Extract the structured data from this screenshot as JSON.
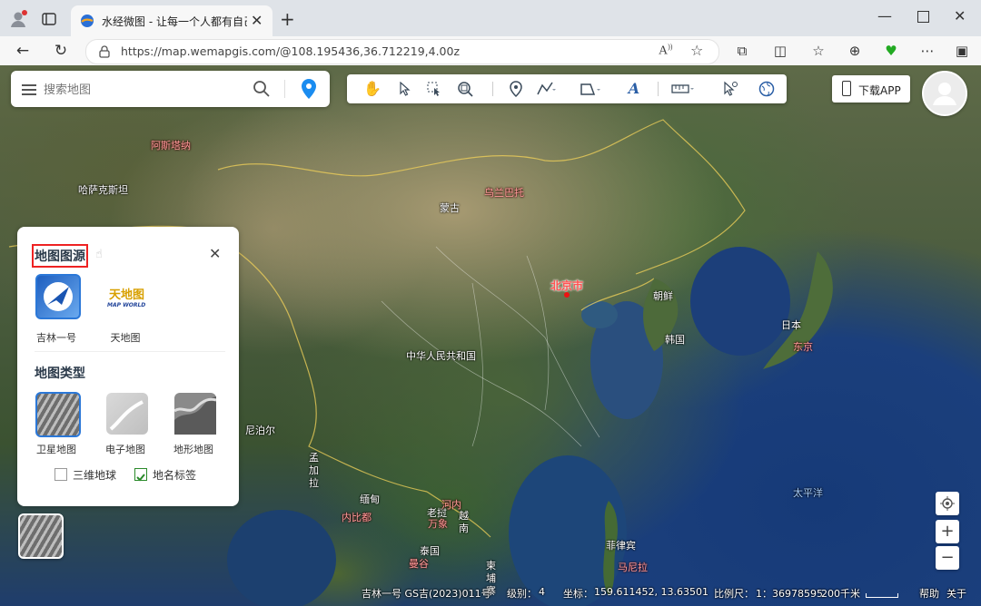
{
  "browser": {
    "tab_title": "水经微图 - 让每一个人都有自己的",
    "url": "https://map.wemapgis.com/@108.195436,36.712219,4.00z",
    "read_aloud_label": "A",
    "icons": [
      "profile-icon",
      "tab-actions-icon",
      "back-icon",
      "reload-icon",
      "lock-icon",
      "favorite-icon",
      "extensions-icon",
      "split-screen-icon",
      "favorites-icon",
      "collections-icon",
      "performance-icon",
      "more-icon",
      "sidebar-icon"
    ]
  },
  "search": {
    "placeholder": "搜索地图"
  },
  "toolbar": {
    "tools": [
      "pan-hand-icon",
      "select-arrow-icon",
      "box-select-icon",
      "zoom-box-icon",
      "marker-icon",
      "polyline-icon",
      "polygon-icon",
      "text-icon",
      "measure-ruler-icon",
      "pick-icon",
      "globe-icon"
    ]
  },
  "download_app": {
    "label": "下载APP"
  },
  "layer_panel": {
    "source_title": "地图图源",
    "sources": [
      {
        "label": "吉林一号"
      },
      {
        "label": "天地图"
      }
    ],
    "tianditu_logo_text": "天地图",
    "tianditu_logo_sub": "MAP WORLD",
    "type_title": "地图类型",
    "types": [
      {
        "label": "卫星地图",
        "selected": true
      },
      {
        "label": "电子地图",
        "selected": false
      },
      {
        "label": "地形地图",
        "selected": false
      }
    ],
    "options": [
      {
        "label": "三维地球",
        "checked": false
      },
      {
        "label": "地名标签",
        "checked": true
      }
    ]
  },
  "map_labels": {
    "countries": [
      {
        "text": "哈萨克斯坦"
      },
      {
        "text": "蒙古"
      },
      {
        "text": "中华人民共和国"
      },
      {
        "text": "朝鲜"
      },
      {
        "text": "韩国"
      },
      {
        "text": "日本"
      },
      {
        "text": "尼泊尔"
      },
      {
        "text": "缅甸"
      },
      {
        "text": "老挝"
      },
      {
        "text": "泰国"
      },
      {
        "text": "菲律宾"
      },
      {
        "text": "太平洋"
      }
    ],
    "vertical_labels": [
      {
        "text": "孟加拉"
      },
      {
        "text": "越南"
      },
      {
        "text": "柬埔寨"
      }
    ],
    "cities": [
      {
        "text": "阿斯塔纳"
      },
      {
        "text": "乌兰巴托"
      },
      {
        "text": "东京"
      },
      {
        "text": "内比都"
      },
      {
        "text": "河内"
      },
      {
        "text": "万象"
      },
      {
        "text": "曼谷"
      },
      {
        "text": "马尼拉"
      }
    ],
    "capital": {
      "text": "北京市"
    }
  },
  "status": {
    "source": "吉林一号 GS吉(2023)011号",
    "level_label": "级别：",
    "level": "4",
    "coord_label": "坐标：",
    "coords": "159.611452, 13.63501",
    "scale_label": "比例尺：",
    "scale": "1：36978595",
    "scale_bar": "200千米",
    "help": "帮助",
    "about": "关于"
  },
  "map_controls": {
    "zoom_in": "+",
    "zoom_out": "−"
  }
}
